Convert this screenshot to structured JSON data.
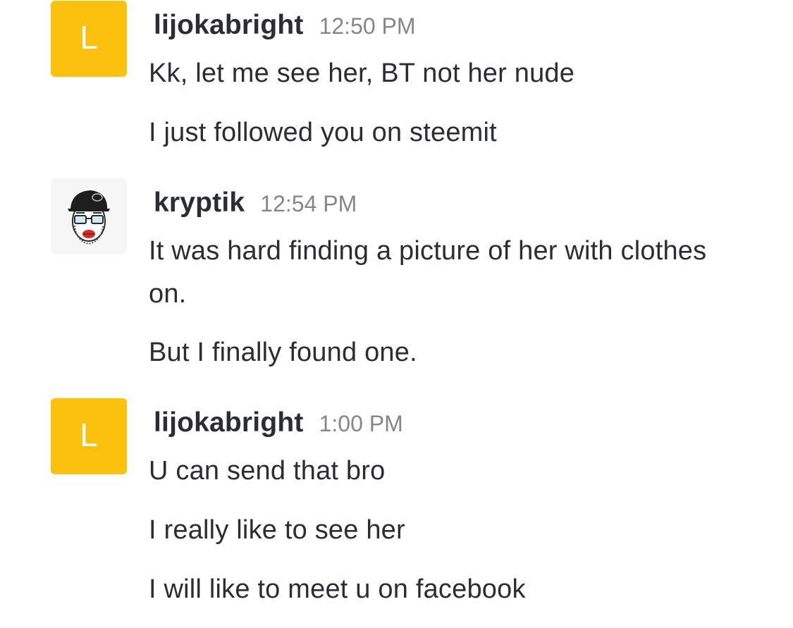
{
  "messages": [
    {
      "avatar_letter": "L",
      "username": "lijokabright",
      "time": "12:50 PM",
      "lines": [
        "Kk, let me see her, BT not her nude",
        "I just followed you on steemit"
      ]
    },
    {
      "username": "kryptik",
      "time": "12:54 PM",
      "lines": [
        "It was hard finding a picture of her with clothes on.",
        "But I finally found one."
      ]
    },
    {
      "avatar_letter": "L",
      "username": "lijokabright",
      "time": "1:00 PM",
      "lines": [
        "U can send that bro",
        "I really like to see her",
        "I will like to meet u on facebook"
      ]
    }
  ],
  "colors": {
    "avatar_yellow": "#fcc10f",
    "text": "#2c2d30",
    "timestamp": "#868686"
  },
  "icons": {
    "kryptik_avatar": "cartoon-face-with-cap-and-glasses-icon"
  }
}
